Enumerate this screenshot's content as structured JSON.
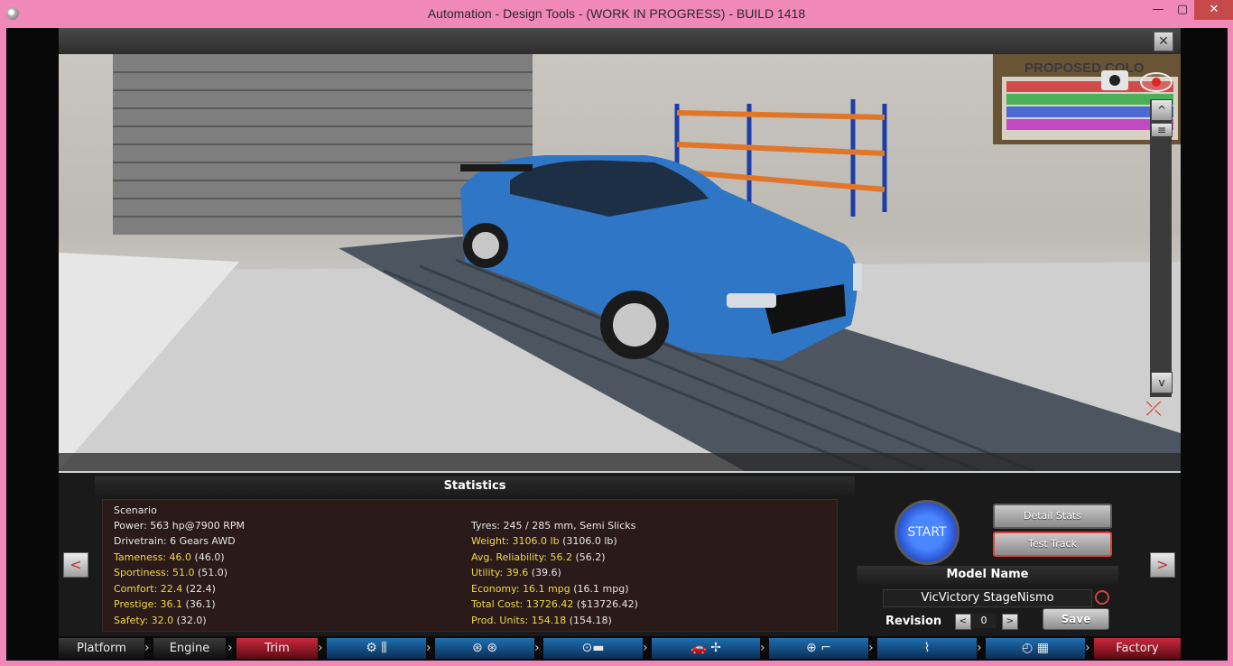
{
  "window": {
    "title": "Automation - Design Tools - (WORK IN PROGRESS) - BUILD 1418"
  },
  "viewport": {
    "poster_text": "PROPOSED COLO"
  },
  "statistics": {
    "title": "Statistics",
    "left": [
      {
        "label": "Scenario",
        "value": "",
        "base": "",
        "highlight": false
      },
      {
        "label": "Power:",
        "value": "563 hp@7900 RPM",
        "base": "",
        "highlight": false
      },
      {
        "label": "Drivetrain:",
        "value": "6 Gears AWD",
        "base": "",
        "highlight": false
      },
      {
        "label": "Tameness:",
        "value": "46.0",
        "base": "(46.0)",
        "highlight": true
      },
      {
        "label": "Sportiness:",
        "value": "51.0",
        "base": "(51.0)",
        "highlight": true
      },
      {
        "label": "Comfort:",
        "value": "22.4",
        "base": "(22.4)",
        "highlight": true
      },
      {
        "label": "Prestige:",
        "value": "36.1",
        "base": "(36.1)",
        "highlight": true
      },
      {
        "label": "Safety:",
        "value": "32.0",
        "base": "(32.0)",
        "highlight": true
      }
    ],
    "right": [
      {
        "label": "",
        "value": "",
        "base": "",
        "highlight": false
      },
      {
        "label": "Tyres:",
        "value": "245 / 285 mm, Semi Slicks",
        "base": "",
        "highlight": false
      },
      {
        "label": "Weight:",
        "value": "3106.0 lb",
        "base": "(3106.0 lb)",
        "highlight": true
      },
      {
        "label": "Avg. Reliability:",
        "value": "56.2",
        "base": "(56.2)",
        "highlight": true
      },
      {
        "label": "Utility:",
        "value": "39.6",
        "base": "(39.6)",
        "highlight": true
      },
      {
        "label": "Economy:",
        "value": "16.1 mpg",
        "base": "(16.1 mpg)",
        "highlight": true
      },
      {
        "label": "Total Cost:",
        "value": "13726.42",
        "base": "($13726.42)",
        "highlight": true
      },
      {
        "label": "Prod. Units:",
        "value": "154.18",
        "base": "(154.18)",
        "highlight": true
      }
    ]
  },
  "controls": {
    "start": "START",
    "detail_stats": "Detail Stats",
    "test_track": "Test Track",
    "model_name_header": "Model Name",
    "model_name_value": "VicVictory StageNismo",
    "revision_label": "Revision",
    "revision_value": "0",
    "save": "Save",
    "prev": "<",
    "next": ">"
  },
  "nav": {
    "tabs": [
      "Platform",
      "Engine",
      "Trim",
      "",
      "",
      "",
      "",
      "",
      "",
      "",
      "Factory"
    ],
    "icons": [
      "gears-icon",
      "wheels-icon",
      "chassis-icon",
      "car-body-fan-icon",
      "steering-seat-icon",
      "suspension-icon",
      "speedometer-checker-icon"
    ]
  },
  "colors": {
    "accent_red": "#c8283c",
    "start_blue": "#1d3fbf",
    "stat_yellow": "#f2d83c"
  }
}
